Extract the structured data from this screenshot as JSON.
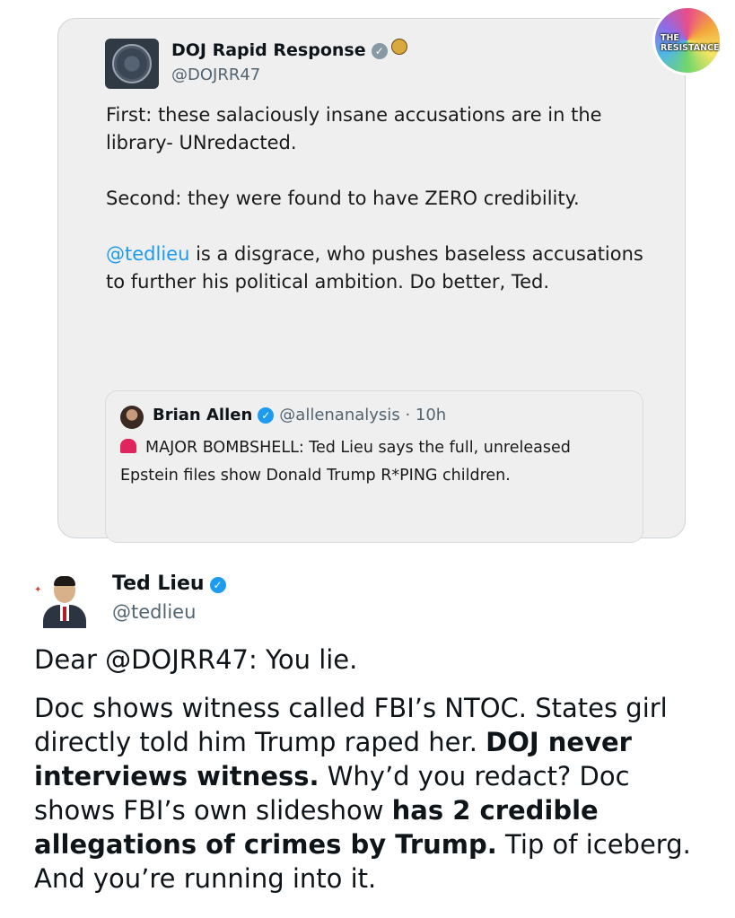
{
  "doj_post": {
    "name": "DOJ Rapid Response",
    "handle": "@DOJRR47",
    "paragraph1": "First: these salaciously insane accusations are in the library- UNredacted.",
    "paragraph2": "Second: they were found to have ZERO credibility.",
    "mention": "@tedlieu",
    "paragraph3_rest": " is a disgrace, who pushes baseless accusations to further his political ambition. Do better, Ted."
  },
  "quoted_post": {
    "name": "Brian Allen",
    "handle": "@allenanalysis",
    "separator": "·",
    "time": "10h",
    "text": "MAJOR BOMBSHELL: Ted Lieu says the full, unreleased Epstein files show Donald Trump R*PING children."
  },
  "watermark": {
    "line1": "THE",
    "line2": "RESISTANCE"
  },
  "ted_post": {
    "name": "Ted Lieu",
    "handle": "@tedlieu",
    "line1": "Dear @DOJRR47: You lie.",
    "p2_a": "Doc shows witness called FBI’s NTOC. States girl directly told him Trump raped her. ",
    "p2_b_bold": "DOJ never interviews witness.",
    "p2_c": " Why’d you redact? Doc shows FBI’s own slideshow ",
    "p2_d_bold": "has 2 credible allegations of crimes by Trump.",
    "p2_e": " Tip of iceberg. And you’re running into it."
  },
  "icons": {
    "verified_gray": "verified-gray-icon",
    "dept_badge": "doj-seal-badge-icon",
    "verified_blue": "verified-blue-icon",
    "siren": "siren-emoji-icon"
  },
  "colors": {
    "link": "#1d9bf0",
    "muted": "#536471",
    "card_bg": "#efefef"
  }
}
